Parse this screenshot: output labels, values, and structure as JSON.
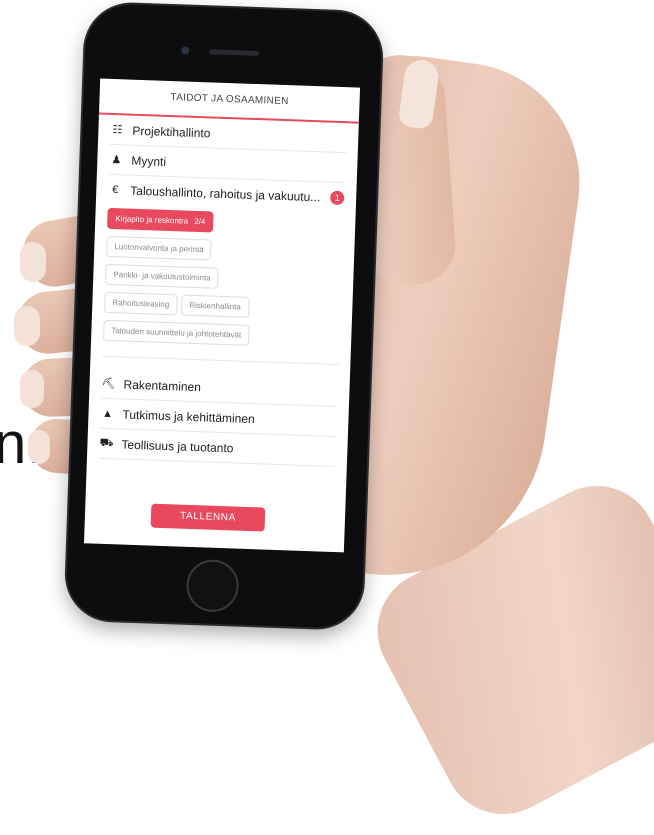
{
  "background": {
    "text": "n."
  },
  "screen": {
    "title": "TAIDOT JA OSAAMINEN",
    "categories_top": [
      {
        "icon": "sitemap-icon",
        "glyph": "☷",
        "label": "Projektihallinto"
      },
      {
        "icon": "users-icon",
        "glyph": "♟",
        "label": "Myynti"
      }
    ],
    "open_category": {
      "icon": "euro-icon",
      "glyph": "€",
      "label": "Taloushallinto, rahoitus ja vakuutu...",
      "count": "1"
    },
    "chips": [
      {
        "label": "Kirjapito ja reskontra",
        "extra": "2/4",
        "active": true
      },
      {
        "label": "Luotonvalvonta ja perintä",
        "active": false
      },
      {
        "label": "Pankki- ja vakuutustoiminta",
        "active": false
      },
      {
        "label": "Rahoitusleasing",
        "active": false
      },
      {
        "label": "Riskienhallinta",
        "active": false
      },
      {
        "label": "Talouden suunnittelu ja johtotehtävät",
        "active": false
      }
    ],
    "categories_bottom": [
      {
        "icon": "construction-icon",
        "glyph": "⛏",
        "label": "Rakentaminen"
      },
      {
        "icon": "graduation-cap-icon",
        "glyph": "▲",
        "label": "Tutkimus ja kehittäminen"
      },
      {
        "icon": "truck-icon",
        "glyph": "⛟",
        "label": "Teollisuus ja tuotanto"
      }
    ],
    "save_label": "TALLENNA"
  },
  "colors": {
    "accent": "#e8495d",
    "phone": "#0d0d0f",
    "skin": "#e8c3b2"
  }
}
